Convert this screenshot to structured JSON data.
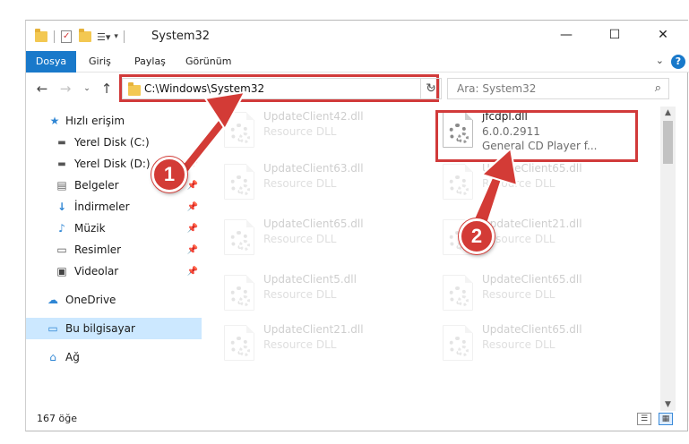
{
  "window": {
    "title": "System32"
  },
  "title_buttons": {
    "minimize": "—",
    "maximize": "☐",
    "close": "✕"
  },
  "ribbon": {
    "tabs": [
      "Dosya",
      "Giriş",
      "Paylaş",
      "Görünüm"
    ],
    "help": "?"
  },
  "address": {
    "path": "C:\\Windows\\System32"
  },
  "search": {
    "placeholder": "Ara: System32"
  },
  "sidebar": {
    "items": [
      {
        "label": "Hızlı erişim",
        "icon": "star-icon"
      },
      {
        "label": "Yerel Disk (C:)",
        "icon": "drive-icon"
      },
      {
        "label": "Yerel Disk (D:)",
        "icon": "drive-icon"
      },
      {
        "label": "Belgeler",
        "icon": "documents-icon"
      },
      {
        "label": "İndirmeler",
        "icon": "download-icon"
      },
      {
        "label": "Müzik",
        "icon": "music-icon"
      },
      {
        "label": "Resimler",
        "icon": "pictures-icon"
      },
      {
        "label": "Videolar",
        "icon": "video-icon"
      },
      {
        "label": "OneDrive",
        "icon": "cloud-icon"
      },
      {
        "label": "Bu bilgisayar",
        "icon": "computer-icon"
      },
      {
        "label": "Ağ",
        "icon": "network-icon"
      }
    ]
  },
  "files": [
    {
      "name": "UpdateClient42.dll",
      "type": "Resource DLL"
    },
    {
      "name": "jfcdpl.dll",
      "version": "6.0.0.2911",
      "description": "General CD Player f..."
    },
    {
      "name": "UpdateClient63.dll",
      "type": "Resource DLL"
    },
    {
      "name": "UpdateClient65.dll",
      "type": "Resource DLL"
    },
    {
      "name": "UpdateClient65.dll",
      "type": "Resource DLL"
    },
    {
      "name": "UpdateClient21.dll",
      "type": "Resource DLL"
    },
    {
      "name": "UpdateClient5.dll",
      "type": "Resource DLL"
    },
    {
      "name": "UpdateClient65.dll",
      "type": "Resource DLL"
    },
    {
      "name": "UpdateClient21.dll",
      "type": "Resource DLL"
    },
    {
      "name": "UpdateClient65.dll",
      "type": "Resource DLL"
    }
  ],
  "status": {
    "count": "167 öğe"
  },
  "callouts": [
    "1",
    "2"
  ],
  "colors": {
    "accent": "#1979ca",
    "highlight": "#d13a3a",
    "selected": "#cce8ff"
  }
}
